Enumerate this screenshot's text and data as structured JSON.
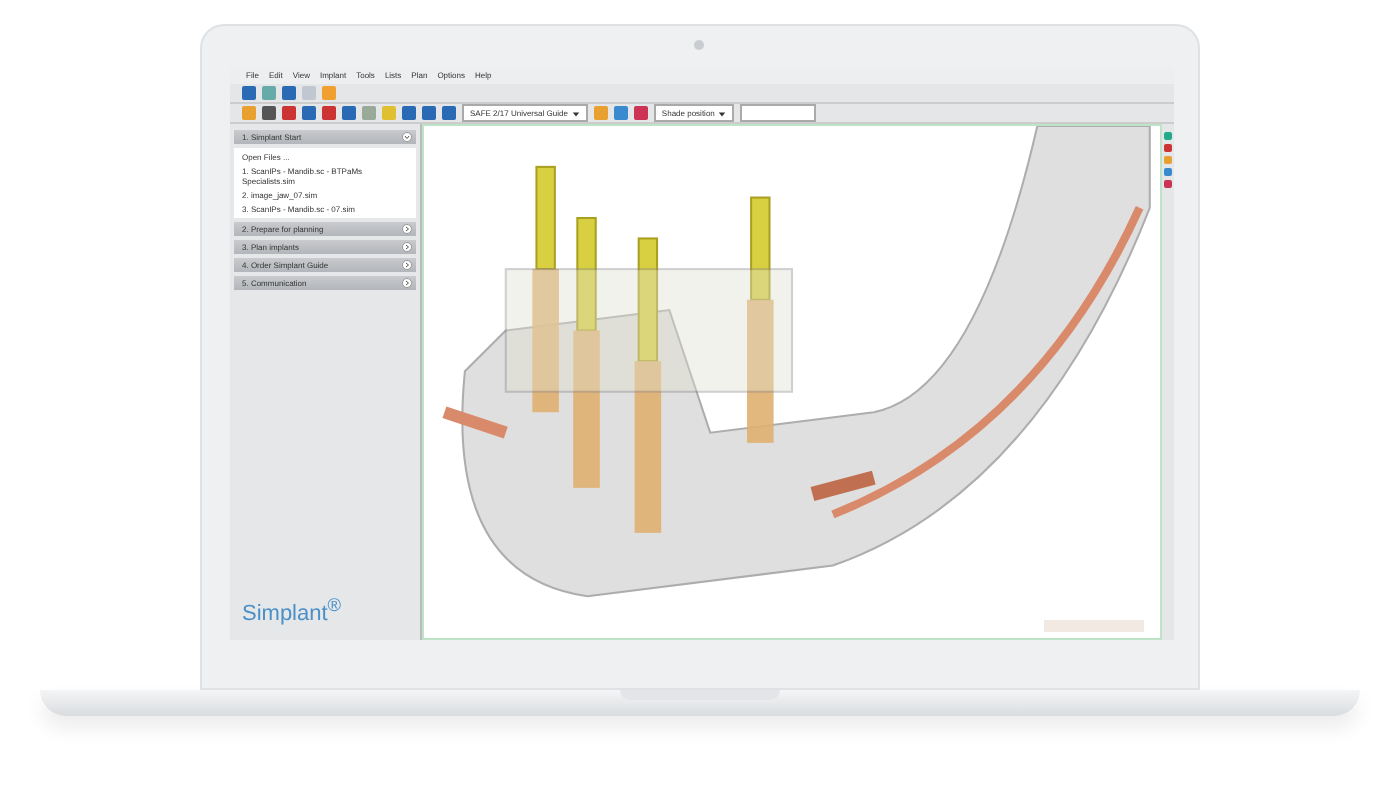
{
  "menu": [
    "File",
    "Edit",
    "View",
    "Implant",
    "Tools",
    "Lists",
    "Plan",
    "Options",
    "Help"
  ],
  "toolbar": {
    "guide_select": "SAFE 2/17 Universal Guide",
    "position_select": "Shade position"
  },
  "panel": {
    "sections": [
      {
        "title": "1. Simplant Start",
        "expanded": true,
        "open_link": "Open Files ...",
        "files": [
          "1. ScanIPs - Mandib.sc - BTPaMs Specialists.sim",
          "2. image_jaw_07.sim",
          "3. ScanIPs - Mandib.sc - 07.sim"
        ]
      },
      {
        "title": "2. Prepare for planning",
        "expanded": false
      },
      {
        "title": "3. Plan implants",
        "expanded": false
      },
      {
        "title": "4. Order Simplant Guide",
        "expanded": false
      },
      {
        "title": "5. Communication",
        "expanded": false
      }
    ]
  },
  "logo": "Simplant$^{®}$"
}
